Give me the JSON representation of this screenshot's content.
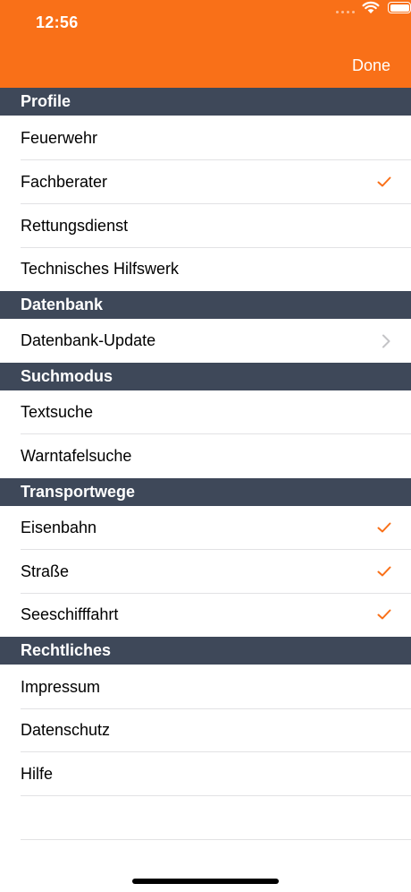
{
  "status_bar": {
    "time": "12:56"
  },
  "nav": {
    "done_label": "Done",
    "accent_color": "#f97018"
  },
  "sections": [
    {
      "title": "Profile",
      "items": [
        {
          "label": "Feuerwehr",
          "accessory": "none"
        },
        {
          "label": "Fachberater",
          "accessory": "checkmark"
        },
        {
          "label": "Rettungsdienst",
          "accessory": "none"
        },
        {
          "label": "Technisches Hilfswerk",
          "accessory": "none"
        }
      ]
    },
    {
      "title": "Datenbank",
      "items": [
        {
          "label": "Datenbank-Update",
          "accessory": "chevron"
        }
      ]
    },
    {
      "title": "Suchmodus",
      "items": [
        {
          "label": "Textsuche",
          "accessory": "none"
        },
        {
          "label": "Warntafelsuche",
          "accessory": "none"
        }
      ]
    },
    {
      "title": "Transportwege",
      "items": [
        {
          "label": "Eisenbahn",
          "accessory": "checkmark"
        },
        {
          "label": "Straße",
          "accessory": "checkmark"
        },
        {
          "label": "Seeschifffahrt",
          "accessory": "checkmark"
        }
      ]
    },
    {
      "title": "Rechtliches",
      "items": [
        {
          "label": "Impressum",
          "accessory": "none"
        },
        {
          "label": "Datenschutz",
          "accessory": "none"
        },
        {
          "label": "Hilfe",
          "accessory": "none"
        }
      ]
    }
  ]
}
